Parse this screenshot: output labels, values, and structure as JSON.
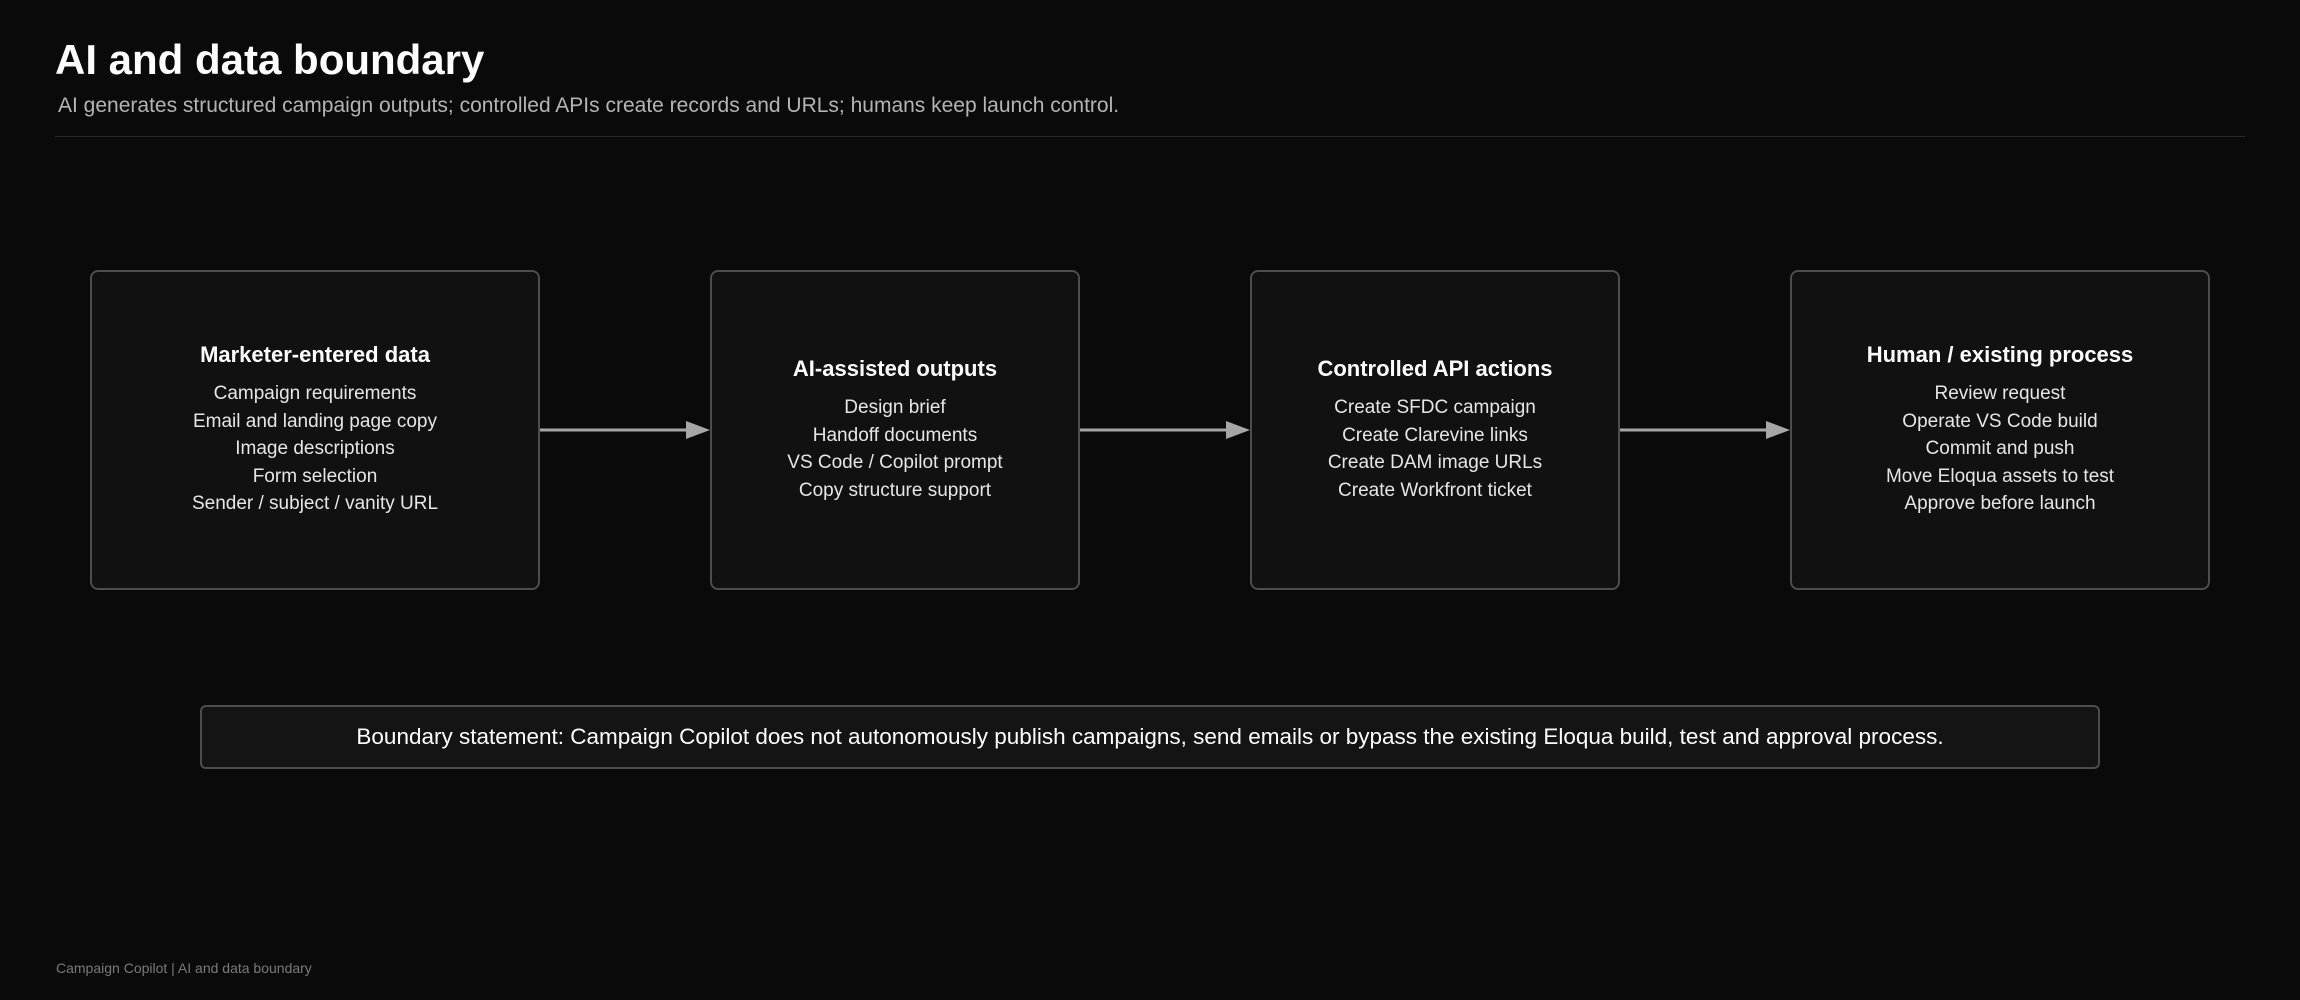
{
  "header": {
    "title": "AI and data boundary",
    "subtitle": "AI generates structured campaign outputs; controlled APIs create records and URLs; humans keep launch control."
  },
  "flow": [
    {
      "title": "Marketer-entered data",
      "items": [
        "Campaign requirements",
        "Email and landing page copy",
        "Image descriptions",
        "Form selection",
        "Sender / subject / vanity URL"
      ]
    },
    {
      "title": "AI-assisted outputs",
      "items": [
        "Design brief",
        "Handoff documents",
        "VS Code / Copilot prompt",
        "Copy structure support"
      ]
    },
    {
      "title": "Controlled API actions",
      "items": [
        "Create SFDC campaign",
        "Create Clarevine links",
        "Create DAM image URLs",
        "Create Workfront ticket"
      ]
    },
    {
      "title": "Human / existing process",
      "items": [
        "Review request",
        "Operate VS Code build",
        "Commit and push",
        "Move Eloqua assets to test",
        "Approve before launch"
      ]
    }
  ],
  "boundary": {
    "text": "Boundary statement: Campaign Copilot does not autonomously publish campaigns, send emails or bypass the existing Eloqua build, test and approval process."
  },
  "footer": {
    "text": "Campaign Copilot | AI and data boundary"
  },
  "colors": {
    "background": "#0a0a0a",
    "box_border": "#4d4d4d",
    "box_fill": "#111111",
    "arrow": "#a6a6a6",
    "subtitle": "#b4b4b4",
    "footer": "#7a7a7a"
  }
}
